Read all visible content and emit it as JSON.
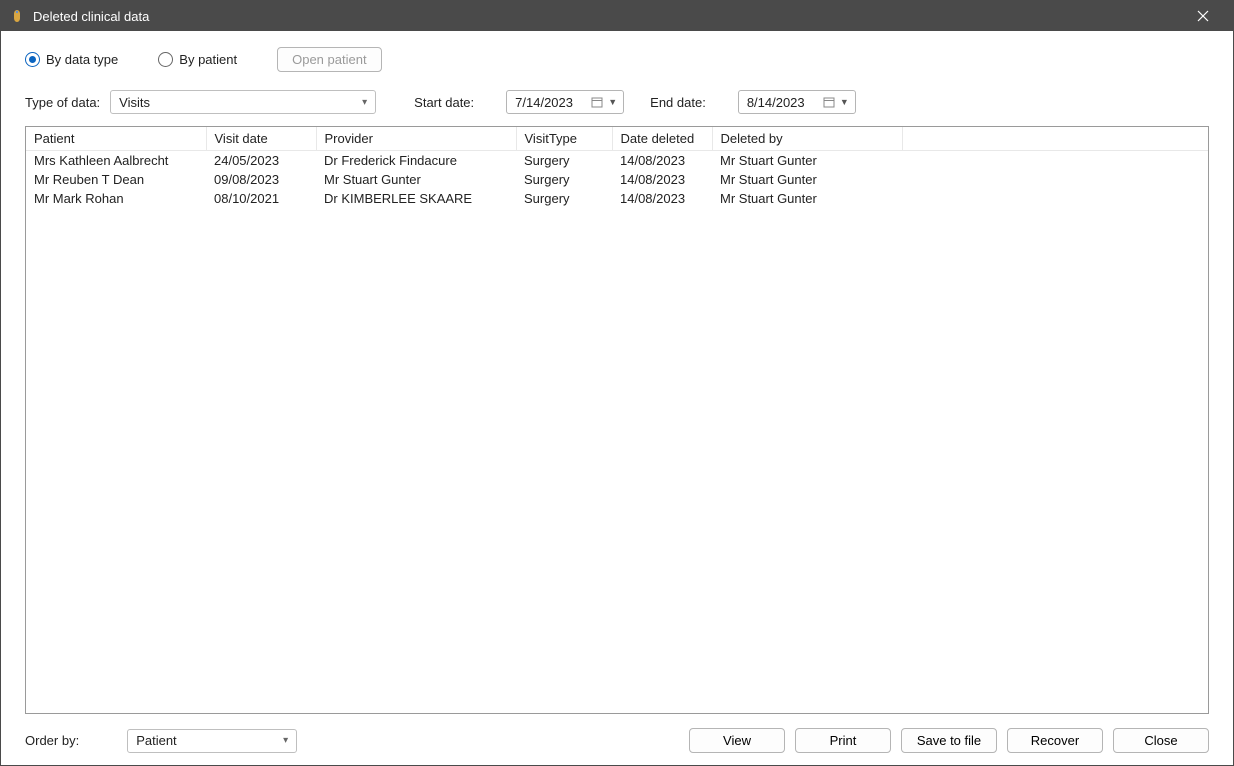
{
  "window": {
    "title": "Deleted clinical data"
  },
  "top": {
    "radio_by_data_type": "By data type",
    "radio_by_patient": "By patient",
    "open_patient_btn": "Open patient"
  },
  "filters": {
    "type_of_data_label": "Type of data:",
    "type_of_data_value": "Visits",
    "start_date_label": "Start date:",
    "start_date_value": "7/14/2023",
    "end_date_label": "End date:",
    "end_date_value": "8/14/2023"
  },
  "table": {
    "headers": {
      "patient": "Patient",
      "visit_date": "Visit date",
      "provider": "Provider",
      "visit_type": "VisitType",
      "date_deleted": "Date deleted",
      "deleted_by": "Deleted by"
    },
    "rows": [
      {
        "patient": "Mrs Kathleen Aalbrecht",
        "visit_date": "24/05/2023",
        "provider": "Dr Frederick Findacure",
        "visit_type": "Surgery",
        "date_deleted": "14/08/2023",
        "deleted_by": "Mr Stuart Gunter"
      },
      {
        "patient": "Mr Reuben T Dean",
        "visit_date": "09/08/2023",
        "provider": "Mr Stuart Gunter",
        "visit_type": "Surgery",
        "date_deleted": "14/08/2023",
        "deleted_by": "Mr Stuart Gunter"
      },
      {
        "patient": "Mr Mark Rohan",
        "visit_date": "08/10/2021",
        "provider": "Dr KIMBERLEE SKAARE",
        "visit_type": "Surgery",
        "date_deleted": "14/08/2023",
        "deleted_by": "Mr Stuart Gunter"
      }
    ]
  },
  "bottom": {
    "order_by_label": "Order by:",
    "order_by_value": "Patient",
    "view_btn": "View",
    "print_btn": "Print",
    "save_btn": "Save to file",
    "recover_btn": "Recover",
    "close_btn": "Close"
  }
}
